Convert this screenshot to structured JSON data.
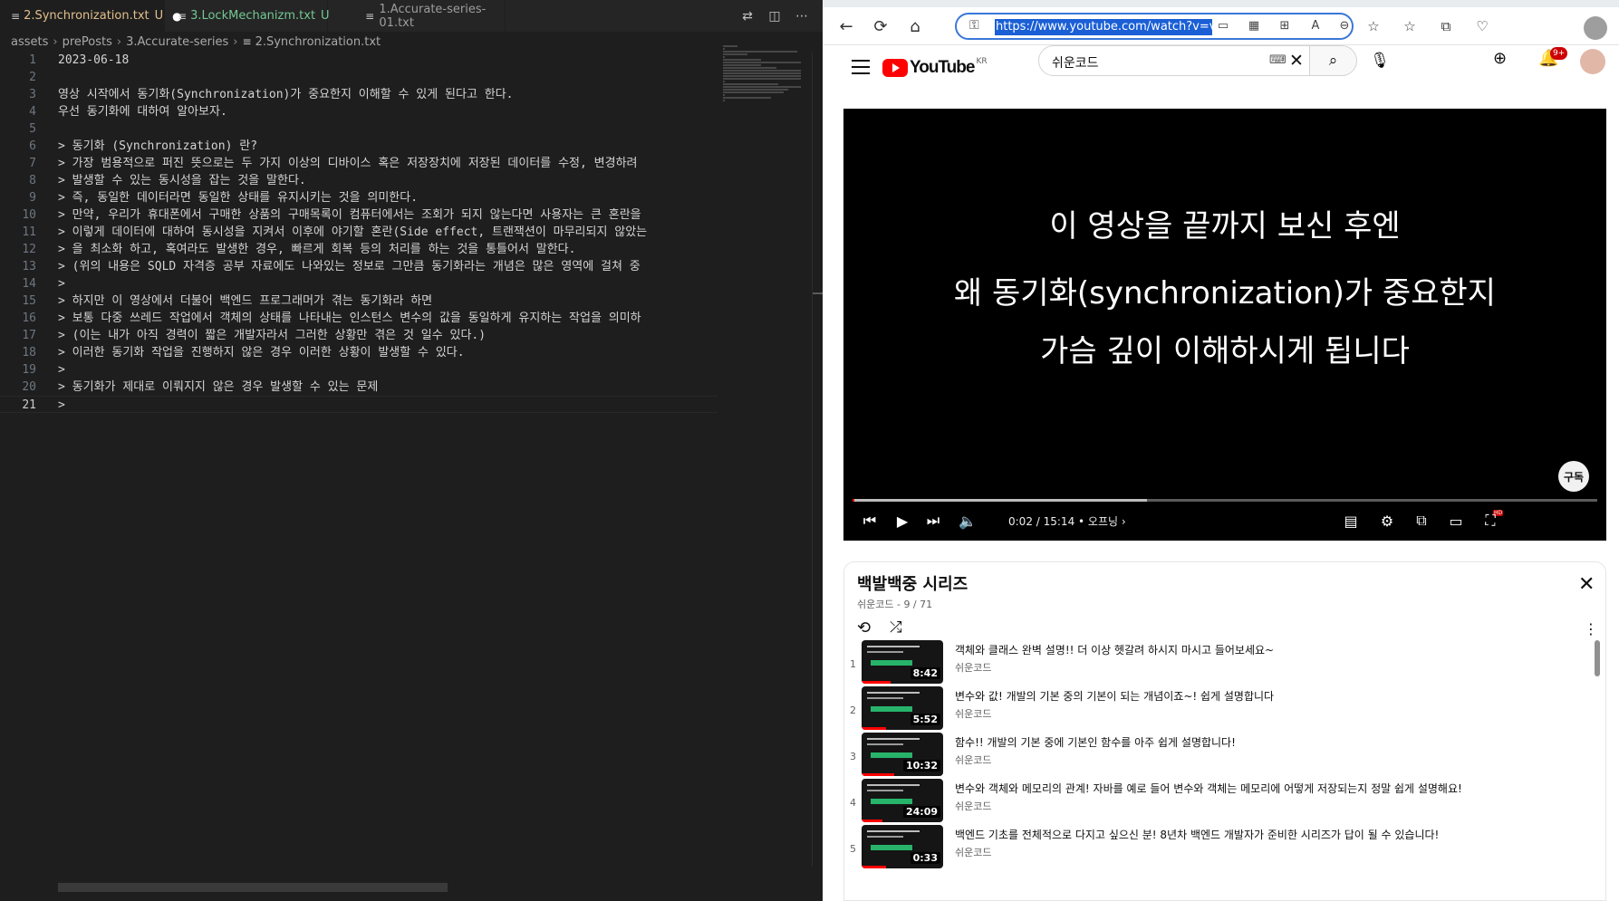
{
  "editor": {
    "tabs": [
      {
        "icon": "≡",
        "label": "2.Synchronization.txt",
        "status": "U",
        "modified": "●"
      },
      {
        "icon": "≡",
        "label": "3.LockMechanizm.txt",
        "status": "U",
        "modified": ""
      },
      {
        "icon": "≡",
        "label": "1.Accurate-series-01.txt",
        "status": "",
        "modified": ""
      }
    ],
    "breadcrumb": [
      "assets",
      "prePosts",
      "3.Accurate-series",
      "2.Synchronization.txt"
    ],
    "lines": [
      {
        "n": "1",
        "text": "2023-06-18"
      },
      {
        "n": "2",
        "text": ""
      },
      {
        "n": "3",
        "text": "영상 시작에서 동기화(Synchronization)가 중요한지 이해할 수 있게 된다고 한다."
      },
      {
        "n": "4",
        "text": "우선 동기화에 대하여 알아보자."
      },
      {
        "n": "5",
        "text": ""
      },
      {
        "n": "6",
        "text": "> 동기화 (Synchronization) 란?"
      },
      {
        "n": "7",
        "text": "> 가장 범용적으로 퍼진 뜻으로는 두 가지 이상의 디바이스 혹은 저장장치에 저장된 데이터를 수정, 변경하려"
      },
      {
        "n": "8",
        "text": "> 발생할 수 있는 동시성을 잡는 것을 말한다."
      },
      {
        "n": "9",
        "text": "> 즉, 동일한 데이터라면 동일한 상태를 유지시키는 것을 의미한다."
      },
      {
        "n": "10",
        "text": "> 만약, 우리가 휴대폰에서 구매한 상품의 구매목록이 컴퓨터에서는 조회가 되지 않는다면 사용자는 큰 혼란을"
      },
      {
        "n": "11",
        "text": "> 이렇게 데이터에 대하여 동시성을 지켜서 이후에 야기할 혼란(Side effect, 트랜잭션이 마무리되지 않았는"
      },
      {
        "n": "12",
        "text": "> 을 최소화 하고, 혹여라도 발생한 경우, 빠르게 회복 등의 처리를 하는 것을 통틀어서 말한다."
      },
      {
        "n": "13",
        "text": "> (위의 내용은 SQLD 자격증 공부 자료에도 나와있는 정보로 그만큼 동기화라는 개념은 많은 영역에 걸쳐 중"
      },
      {
        "n": "14",
        "text": ">"
      },
      {
        "n": "15",
        "text": "> 하지만 이 영상에서 더불어 백엔드 프로그래머가 겪는 동기화라 하면"
      },
      {
        "n": "16",
        "text": "> 보통 다중 쓰레드 작업에서 객체의 상태를 나타내는 인스턴스 변수의 값을 동일하게 유지하는 작업을 의미하"
      },
      {
        "n": "17",
        "text": "> (이는 내가 아직 경력이 짧은 개발자라서 그러한 상황만 겪은 것 일수 있다.)"
      },
      {
        "n": "18",
        "text": "> 이러한 동기화 작업을 진행하지 않은 경우 이러한 상황이 발생할 수 있다."
      },
      {
        "n": "19",
        "text": ">"
      },
      {
        "n": "20",
        "text": "> 동기화가 제대로 이뤄지지 않은 경우 발생할 수 있는 문제"
      },
      {
        "n": "21",
        "text": ">"
      }
    ],
    "current_line": "21",
    "colors": {
      "bg": "#1e1e1e",
      "modified_tab": "#e2c08d",
      "untracked": "#73c991"
    }
  },
  "browser": {
    "url": "https://www.youtube.com/watch?v=vp",
    "icons": {
      "back": "←",
      "refresh": "⟳",
      "home": "⌂",
      "lock": "🔒",
      "favorites": "☆",
      "collections": "⧉",
      "more": "⋯"
    }
  },
  "youtube": {
    "logo_text": "YouTube",
    "region": "KR",
    "search_query": "쉬운코드",
    "notif_badge": "9+",
    "video": {
      "captions": [
        "이 영상을 끝까지 보신 후엔",
        "왜 동기화(synchronization)가 중요한지",
        "가슴 깊이 이해하시게 됩니다"
      ],
      "subscribe_label": "구독",
      "time": "0:02 / 15:14",
      "chapter": "• 오프닝 ›",
      "played_fraction": 0.003,
      "buffered_fraction": 0.395
    },
    "playlist": {
      "title": "백발백중 시리즈",
      "meta": "쉬운코드 - 9 / 71",
      "items": [
        {
          "index": "1",
          "title": "객체와 클래스 완벽 설명!! 더 이상 헷갈려 하시지 마시고 들어보세요~",
          "channel": "쉬운코드",
          "duration": "8:42",
          "watched_fraction": 0.35
        },
        {
          "index": "2",
          "title": "변수와 값! 개발의 기본 중의 기본이 되는 개념이죠~! 쉽게 설명합니다",
          "channel": "쉬운코드",
          "duration": "5:52",
          "watched_fraction": 0.3
        },
        {
          "index": "3",
          "title": "함수!! 개발의 기본 중에 기본인 함수를 아주 쉽게 설명합니다!",
          "channel": "쉬운코드",
          "duration": "10:32",
          "watched_fraction": 0.4
        },
        {
          "index": "4",
          "title": "변수와 객체와 메모리의 관계! 자바를 예로 들어 변수와 객체는 메모리에 어떻게 저장되는지 정말 쉽게 설명해요!",
          "channel": "쉬운코드",
          "duration": "24:09",
          "watched_fraction": 0.25
        },
        {
          "index": "5",
          "title": "백엔드 기초를 전체적으로 다지고 싶으신 분! 8년차 백엔드 개발자가 준비한 시리즈가 답이 될 수 있습니다!",
          "channel": "쉬운코드",
          "duration": "0:33",
          "watched_fraction": 0.3
        }
      ]
    }
  }
}
